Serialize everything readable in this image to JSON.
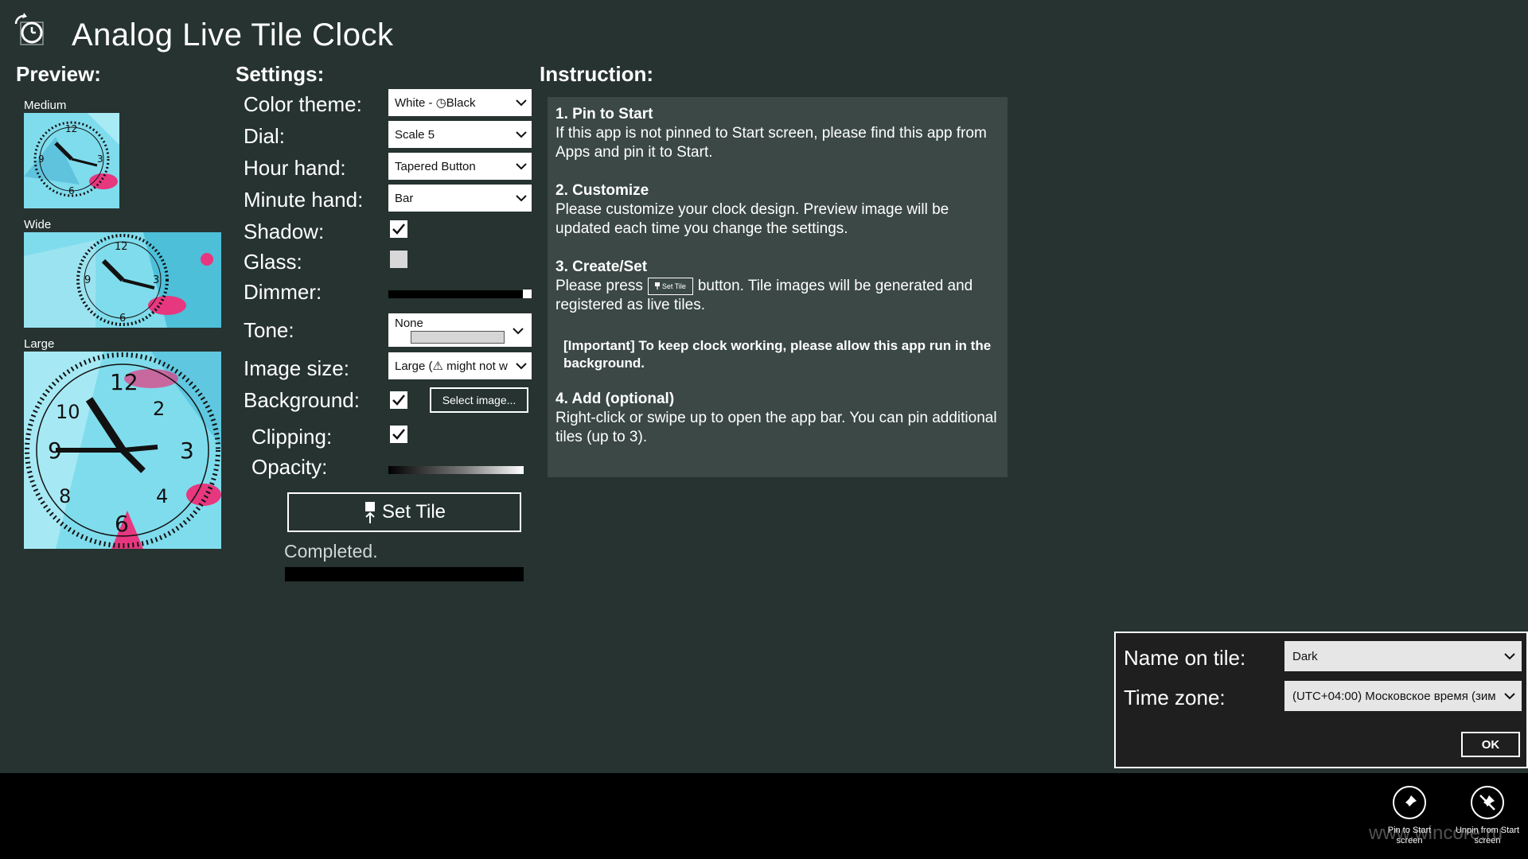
{
  "app": {
    "title": "Analog Live Tile Clock",
    "icon": "clock-refresh-icon"
  },
  "preview": {
    "heading": "Preview:",
    "medium_label": "Medium",
    "wide_label": "Wide",
    "large_label": "Large"
  },
  "settings": {
    "heading": "Settings:",
    "color_theme": {
      "label": "Color theme:",
      "value": "White - ◷Black"
    },
    "dial": {
      "label": "Dial:",
      "value": "Scale 5"
    },
    "hour_hand": {
      "label": "Hour hand:",
      "value": "Tapered Button"
    },
    "minute_hand": {
      "label": "Minute hand:",
      "value": "Bar"
    },
    "shadow": {
      "label": "Shadow:",
      "checked": true
    },
    "glass": {
      "label": "Glass:",
      "checked": false
    },
    "dimmer": {
      "label": "Dimmer:",
      "level": 1.0
    },
    "tone": {
      "label": "Tone:",
      "value": "None"
    },
    "image_size": {
      "label": "Image size:",
      "value": "Large (⚠ might not w"
    },
    "background": {
      "label": "Background:",
      "checked": true,
      "button": "Select image..."
    },
    "clipping": {
      "label": "Clipping:",
      "checked": true
    },
    "opacity": {
      "label": "Opacity:"
    },
    "set_tile_button": "Set Tile",
    "status": "Completed."
  },
  "instructions": {
    "heading": "Instruction:",
    "step1_title": "1. Pin to Start",
    "step1_text": "If this app is not pinned to Start screen, please find this app from Apps and pin it to Start.",
    "step2_title": "2. Customize",
    "step2_text": "Please customize your clock design. Preview image will be updated each time you change the settings.",
    "step3_title": "3. Create/Set",
    "step3_text_before": "Please press",
    "step3_inline_button": "Set Tile",
    "step3_text_after": "button. Tile images will be generated and registered as live tiles.",
    "important": "[Important] To keep clock working, please allow this app run in the background.",
    "step4_title": "4. Add (optional)",
    "step4_text": "Right-click or swipe up to open the app bar. You can pin additional tiles (up to 3)."
  },
  "flyout": {
    "name_label": "Name on tile:",
    "name_value": "Dark",
    "timezone_label": "Time zone:",
    "timezone_value": "(UTC+04:00) Московское время (зим",
    "ok_label": "OK"
  },
  "appbar": {
    "pin_label": "Pin to Start screen",
    "unpin_label": "Unpin from Start screen",
    "pin_icon": "pin-icon",
    "unpin_icon": "unpin-icon"
  },
  "watermark": "www.wincore.ru",
  "colors": {
    "background": "#263330",
    "panel": "#3b4845",
    "tile_cyan": "#7fdcec",
    "tile_pink": "#e6377f",
    "appbar": "#000000"
  }
}
